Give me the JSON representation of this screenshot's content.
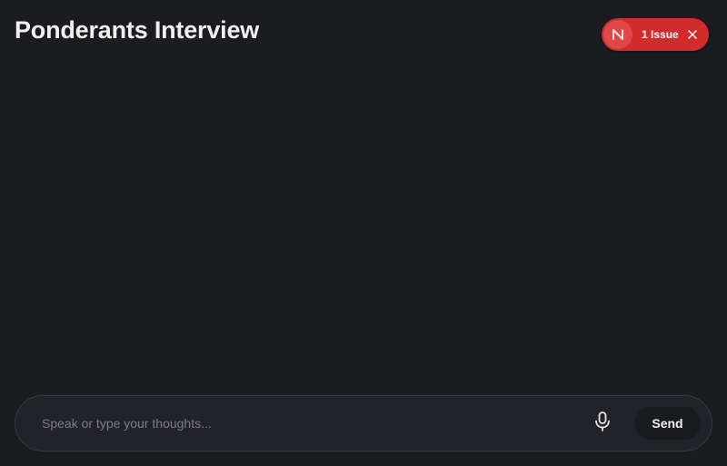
{
  "header": {
    "title": "Ponderants Interview"
  },
  "issue_badge": {
    "logo_letter": "N",
    "label": "1 Issue",
    "logo_icon": "next-logo-icon",
    "close_icon": "close-icon",
    "color": "#d22b2b"
  },
  "composer": {
    "value": "",
    "placeholder": "Speak or type your thoughts...",
    "mic_icon": "microphone-icon",
    "send_label": "Send"
  },
  "colors": {
    "background": "#1b1c20",
    "composer_background": "#222328",
    "text": "#f0f0f0",
    "placeholder": "#7c7d83"
  }
}
